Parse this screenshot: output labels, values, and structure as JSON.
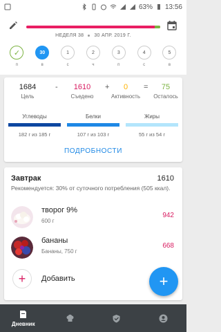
{
  "status_bar": {
    "battery": "63%",
    "time": "13:56"
  },
  "header": {
    "week": "НЕДЕЛЯ 38",
    "date": "30 АПР. 2019 Г.",
    "progress_eaten_fraction": 0.96
  },
  "days": [
    {
      "label": "",
      "letter": "п",
      "state": "done"
    },
    {
      "label": "30",
      "letter": "в",
      "state": "active"
    },
    {
      "label": "1",
      "letter": "с",
      "state": "normal"
    },
    {
      "label": "2",
      "letter": "ч",
      "state": "normal"
    },
    {
      "label": "3",
      "letter": "п",
      "state": "normal"
    },
    {
      "label": "4",
      "letter": "с",
      "state": "normal"
    },
    {
      "label": "5",
      "letter": "в",
      "state": "normal"
    }
  ],
  "summary": {
    "goal_value": "1684",
    "goal_label": "Цель",
    "minus": "-",
    "eaten_value": "1610",
    "eaten_label": "Съедено",
    "plus": "+",
    "activity_value": "0",
    "activity_label": "Активность",
    "equals": "=",
    "remaining_value": "75",
    "remaining_label": "Осталось"
  },
  "macros": [
    {
      "name": "Углеводы",
      "value": "182 г из 185 г",
      "color": "#0d47a1"
    },
    {
      "name": "Белки",
      "value": "107 г из 103 г",
      "color": "#1e88e5"
    },
    {
      "name": "Жиры",
      "value": "55 г из 54 г",
      "color": "#b3e5fc"
    }
  ],
  "details_label": "ПОДРОБНОСТИ",
  "meal": {
    "title": "Завтрак",
    "total": "1610",
    "note": "Рекомендуется: 30% от суточного потребления (505 ккал).",
    "items": [
      {
        "name": "творог 9%",
        "sub": "600 г",
        "kcal": "942"
      },
      {
        "name": "бананы",
        "sub": "Бананы, 750 г",
        "kcal": "668"
      }
    ],
    "add_label": "Добавить"
  },
  "fab_label": "+",
  "nav": [
    {
      "label": "Дневник",
      "icon": "diary-icon",
      "active": true
    },
    {
      "label": "",
      "icon": "chef-hat-icon",
      "active": false
    },
    {
      "label": "",
      "icon": "shield-check-icon",
      "active": false
    },
    {
      "label": "",
      "icon": "profile-icon",
      "active": false
    }
  ],
  "colors": {
    "accent_blue": "#2196f3",
    "pink": "#e91e63",
    "green": "#7cb342",
    "orange": "#ffb300"
  }
}
